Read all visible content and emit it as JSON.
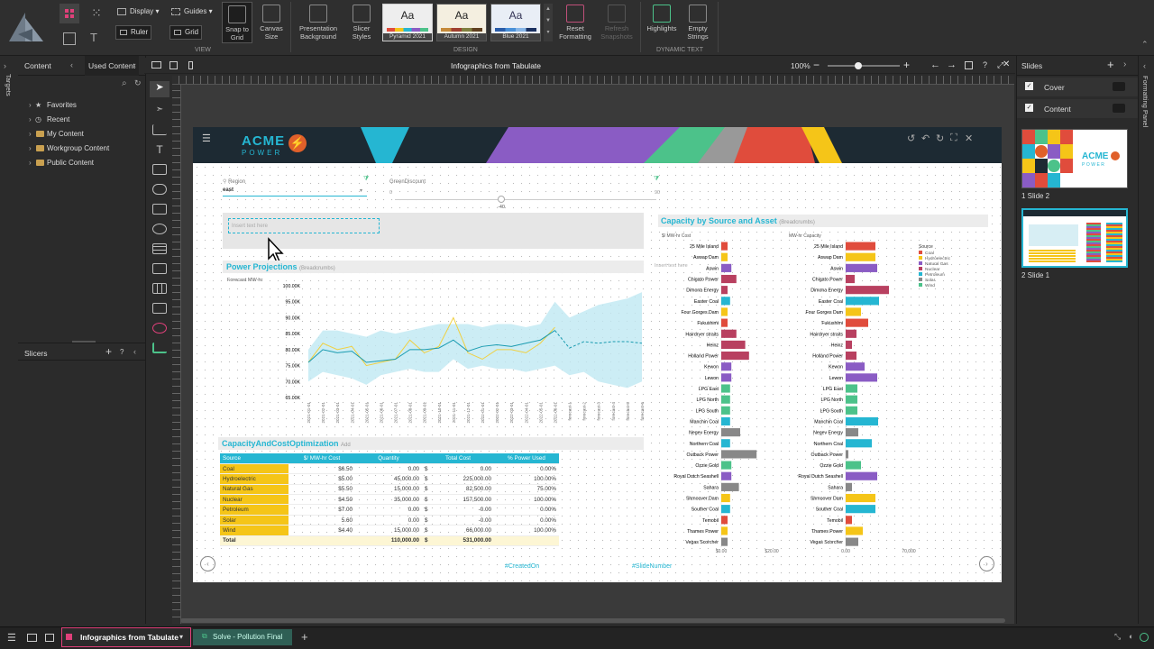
{
  "ribbon": {
    "display_label": "Display",
    "guides_label": "Guides",
    "ruler_label": "Ruler",
    "grid_label": "Grid",
    "snap_label": "Snap to Grid",
    "canvas_size_label": "Canvas Size",
    "view_group": "VIEW",
    "presentation_bg_label": "Presentation Background",
    "slicer_styles_label": "Slicer Styles",
    "themes": [
      {
        "name": "Pyramid 2021",
        "sample": "Aa"
      },
      {
        "name": "Autumn 2021",
        "sample": "Aa"
      },
      {
        "name": "Blue 2021",
        "sample": "Aa"
      }
    ],
    "reset_formatting_label": "Reset Formatting",
    "refresh_snapshots_label": "Refresh Snapshots",
    "design_group": "DESIGN",
    "highlights_label": "Highlights",
    "empty_strings_label": "Empty Strings",
    "dynamic_text_group": "DYNAMIC TEXT"
  },
  "left_panel": {
    "targets_label": "Targets",
    "tabs": [
      "Content",
      "Used Content"
    ],
    "tree": [
      "Favorites",
      "Recent",
      "My Content",
      "Workgroup Content",
      "Public Content"
    ],
    "slicers_label": "Slicers"
  },
  "titlebar": {
    "title": "Infographics from Tabulate",
    "zoom": "100%"
  },
  "right_panel": {
    "title": "Slides",
    "sections": [
      "Cover",
      "Content"
    ],
    "slides": [
      "1 Slide 2",
      "2 Slide 1"
    ],
    "formatting_panel_label": "Formatting Panel"
  },
  "slide": {
    "logo_top": "ACME",
    "logo_bottom": "POWER",
    "filters": [
      {
        "label": "Region",
        "value": "east"
      },
      {
        "label": "GreenDiscount",
        "min": "-40",
        "max": "90",
        "left": "0"
      }
    ],
    "text_placeholder": "Insert text here",
    "text_placeholder2": "Insert text here",
    "power_title": "Power Projections",
    "power_sub": "(Breadcrumbs)",
    "forecast_label": "Forecast MW-hr",
    "capopt_title": "CapacityAndCostOptimization",
    "capopt_sub": "Add",
    "capacity_title": "Capacity by Source and Asset",
    "capacity_sub": "(Breadcrumbs)",
    "footer_created": "#CreatedOn",
    "footer_slide": "#SlideNumber"
  },
  "table": {
    "headers": [
      "Source",
      "$/ MW-hr Cost",
      "Quantity",
      "Total Cost",
      "% Power Used"
    ],
    "rows": [
      [
        "Coal",
        "$6.50",
        "0.00",
        "$",
        "0.00",
        "0.00%"
      ],
      [
        "Hydroelectric",
        "$5.00",
        "45,000.00",
        "$",
        "225,000.00",
        "100.00%"
      ],
      [
        "Natural Gas",
        "$5.50",
        "15,000.00",
        "$",
        "82,500.00",
        "75.00%"
      ],
      [
        "Nuclear",
        "$4.50",
        "35,000.00",
        "$",
        "157,500.00",
        "100.00%"
      ],
      [
        "Petroleum",
        "$7.00",
        "0.00",
        "$",
        "-0.00",
        "0.00%"
      ],
      [
        "Solar",
        "5.60",
        "0.00",
        "$",
        "-0.00",
        "0.00%"
      ],
      [
        "Wind",
        "$4.40",
        "15,000.00",
        "$",
        "66,000.00",
        "100.00%"
      ]
    ],
    "total": [
      "Total",
      "",
      "110,000.00",
      "$",
      "531,000.00",
      ""
    ]
  },
  "chart_data": [
    {
      "type": "line",
      "title": "Power Projections",
      "ylabel": "Forecast MW-hr",
      "yticks": [
        "100.00K",
        "95.00K",
        "90.00K",
        "85.00K",
        "80.00K",
        "75.00K",
        "70.00K",
        "65.00K"
      ],
      "ylim": [
        65000,
        100000
      ],
      "x": [
        "2021-01-01",
        "2021-02-01",
        "2021-03-01",
        "2021-04-01",
        "2021-05-01",
        "2021-06-01",
        "2021-07-01",
        "2021-08-01",
        "2021-09-01",
        "2021-10-01",
        "2021-11-01",
        "2021-12-01",
        "2022-01-01",
        "2022-02-01",
        "2022-03-01",
        "2022-04-01",
        "2022-05-01",
        "2022-06-01",
        "forecast-1",
        "forecast-2",
        "forecast-3",
        "forecast-4",
        "forecast-5",
        "forecast-6"
      ],
      "series": [
        {
          "values": [
            76000,
            82000,
            80000,
            81000,
            75000,
            76000,
            77000,
            83000,
            79000,
            81000,
            90000,
            79000,
            77000,
            80000,
            80000,
            79000,
            82000,
            87000,
            null,
            null,
            null,
            null,
            null,
            null
          ]
        },
        {
          "values": [
            76000,
            80000,
            79000,
            79500,
            76000,
            76500,
            77000,
            80000,
            80000,
            80500,
            83000,
            79500,
            81000,
            81500,
            81000,
            82000,
            83000,
            86000,
            80500,
            82500,
            82000,
            82500,
            82500,
            82000
          ]
        },
        {
          "values_low": [
            70000,
            73000,
            72000,
            71000,
            69000,
            72000,
            73000,
            74000,
            73000,
            73000,
            77000,
            74000,
            75000,
            74000,
            74000,
            73000,
            74000,
            75000,
            72000,
            73000,
            70000,
            69000,
            68000,
            70000
          ],
          "values_high": [
            80000,
            86000,
            86000,
            85000,
            84000,
            86000,
            85000,
            86000,
            87000,
            88000,
            88000,
            88000,
            87000,
            88000,
            88000,
            87000,
            88000,
            95000,
            90000,
            92000,
            94000,
            95000,
            96000,
            98000
          ]
        }
      ]
    },
    {
      "type": "bar",
      "title": "Capacity by Source and Asset",
      "panels": [
        "$/ MW-hr Cost",
        "MW-hr Capacity"
      ],
      "xticks": [
        [
          "$0.00",
          "$20.00"
        ],
        [
          "0.00",
          "70,000"
        ]
      ],
      "xlim": [
        [
          0,
          25
        ],
        [
          0,
          70000
        ]
      ],
      "legend_title": "Source",
      "legend": [
        {
          "name": "Coal",
          "color": "#e04c3c"
        },
        {
          "name": "Hydroelectric",
          "color": "#f5c518"
        },
        {
          "name": "Natural Gas",
          "color": "#8a5cc4"
        },
        {
          "name": "Nuclear",
          "color": "#b84060"
        },
        {
          "name": "Petroleum",
          "color": "#25b6d2"
        },
        {
          "name": "Solar",
          "color": "#888888"
        },
        {
          "name": "Wind",
          "color": "#4cc28a"
        }
      ],
      "categories": [
        "25 Mile Island",
        "Aswap Dam",
        "Aswin",
        "Chigato Power",
        "Dimona Energy",
        "Easter Coal",
        "Four Gorges Dam",
        "Fukushimi",
        "Hairdryer straits",
        "Heinz",
        "Holland Power",
        "Kewon",
        "Lewon",
        "LPG East",
        "LPG North",
        "LPG South",
        "Manchin Coal",
        "Negev Energy",
        "Northern Coal",
        "Outback Power",
        "Ozzie Gold",
        "Royal Dutch Seashell",
        "Sahara",
        "Shmoover Dam",
        "Souther Coal",
        "Temobil",
        "Thames Power",
        "Vegas Scorcher"
      ],
      "colors": [
        "#e04c3c",
        "#f5c518",
        "#8a5cc4",
        "#b84060",
        "#b84060",
        "#25b6d2",
        "#f5c518",
        "#e04c3c",
        "#b84060",
        "#b84060",
        "#b84060",
        "#8a5cc4",
        "#8a5cc4",
        "#4cc28a",
        "#4cc28a",
        "#4cc28a",
        "#25b6d2",
        "#888888",
        "#25b6d2",
        "#888888",
        "#4cc28a",
        "#8a5cc4",
        "#888888",
        "#f5c518",
        "#25b6d2",
        "#e04c3c",
        "#f5c518",
        "#888888"
      ],
      "cost": [
        2.5,
        2.5,
        4,
        6,
        2.5,
        3.5,
        2.5,
        2.5,
        6,
        9.5,
        11,
        4,
        4,
        3.5,
        3.5,
        3.5,
        3.5,
        7.5,
        3.5,
        14,
        4,
        4,
        7,
        3.5,
        3.5,
        2.5,
        2.5,
        2.5
      ],
      "capacity": [
        33000,
        33000,
        35000,
        10000,
        48000,
        37000,
        17000,
        25000,
        12000,
        7000,
        12000,
        21000,
        35000,
        13000,
        13000,
        13000,
        36000,
        14000,
        29000,
        3000,
        17000,
        35000,
        7000,
        33000,
        33000,
        7000,
        19000,
        14000
      ]
    }
  ],
  "bottom": {
    "tabs": [
      "Infographics from Tabulate",
      "Solve - Pollution Final"
    ]
  }
}
